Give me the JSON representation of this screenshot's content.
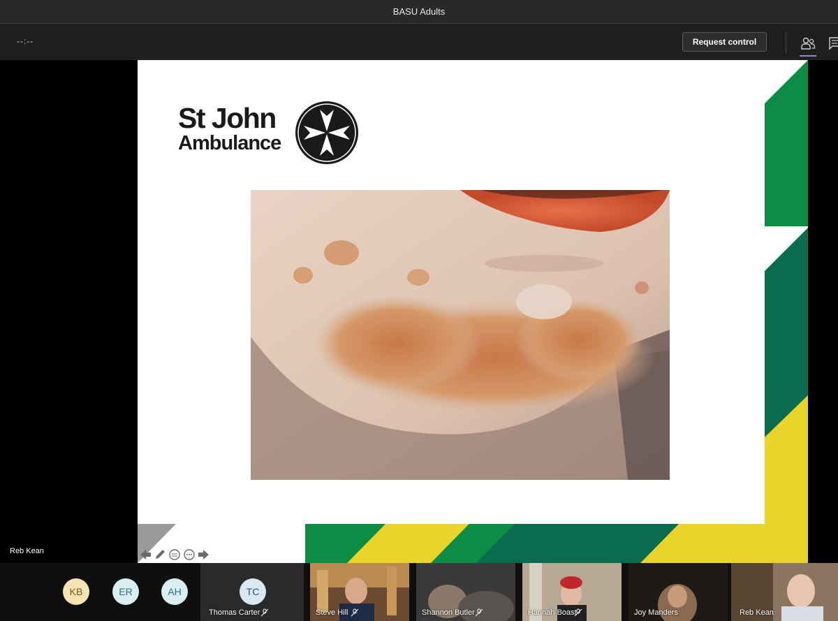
{
  "window": {
    "title": "BASU Adults"
  },
  "toolbar": {
    "timer": "--:--",
    "request_control_label": "Request control",
    "people_icon": "people-icon",
    "chat_icon": "chat-icon"
  },
  "stage": {
    "presenter_name": "Reb Kean",
    "slide": {
      "logo_line1": "St John",
      "logo_line2": "Ambulance",
      "logo_icon": "maltese-cross-icon",
      "colors": {
        "green": "#0d8c45",
        "dark_green": "#0b6b4f",
        "yellow": "#e8d42a",
        "grey": "#9a9a9a"
      }
    },
    "slide_nav": [
      "prev-slide-icon",
      "pen-icon",
      "subtitles-icon",
      "more-icon",
      "next-slide-icon"
    ]
  },
  "participants": [
    {
      "initials": "KB",
      "color": "#f6e3b4",
      "text_color": "#7a5a12"
    },
    {
      "initials": "ER",
      "color": "#d8eef2",
      "text_color": "#2e6f7a"
    },
    {
      "initials": "AH",
      "color": "#d8eef2",
      "text_color": "#2e6f7a"
    },
    {
      "initials": "TC",
      "name": "Thomas Carter",
      "color": "#d8e9f5",
      "text_color": "#2c5470",
      "muted": true
    },
    {
      "name": "Steve Hill",
      "muted": true,
      "video": true
    },
    {
      "name": "Shannon Butler",
      "muted": true,
      "video": true
    },
    {
      "name": "Hannah Boast",
      "muted": true,
      "video": true
    },
    {
      "name": "Joy Manders",
      "muted": false,
      "video": true
    },
    {
      "name": "Reb Kean",
      "muted": false,
      "video": true
    }
  ]
}
